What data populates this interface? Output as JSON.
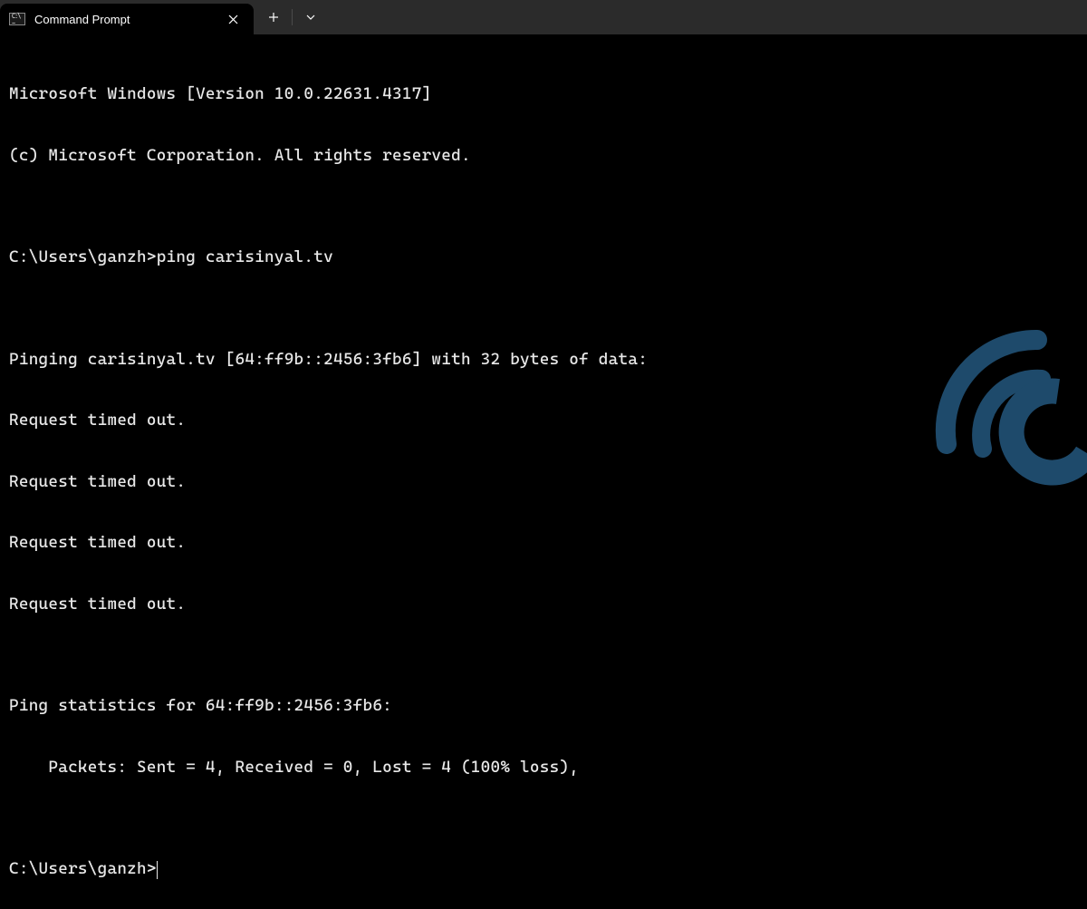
{
  "titlebar": {
    "tab_title": "Command Prompt",
    "close_icon": "✕",
    "new_tab_icon": "+",
    "dropdown_icon": "⌄"
  },
  "terminal": {
    "lines": [
      "Microsoft Windows [Version 10.0.22631.4317]",
      "(c) Microsoft Corporation. All rights reserved.",
      "",
      "C:\\Users\\ganzh>ping carisinyal.tv",
      "",
      "Pinging carisinyal.tv [64:ff9b::2456:3fb6] with 32 bytes of data:",
      "Request timed out.",
      "Request timed out.",
      "Request timed out.",
      "Request timed out.",
      "",
      "Ping statistics for 64:ff9b::2456:3fb6:",
      "    Packets: Sent = 4, Received = 0, Lost = 4 (100% loss),",
      ""
    ],
    "prompt": "C:\\Users\\ganzh>"
  },
  "colors": {
    "watermark": "#1e4a6b"
  }
}
